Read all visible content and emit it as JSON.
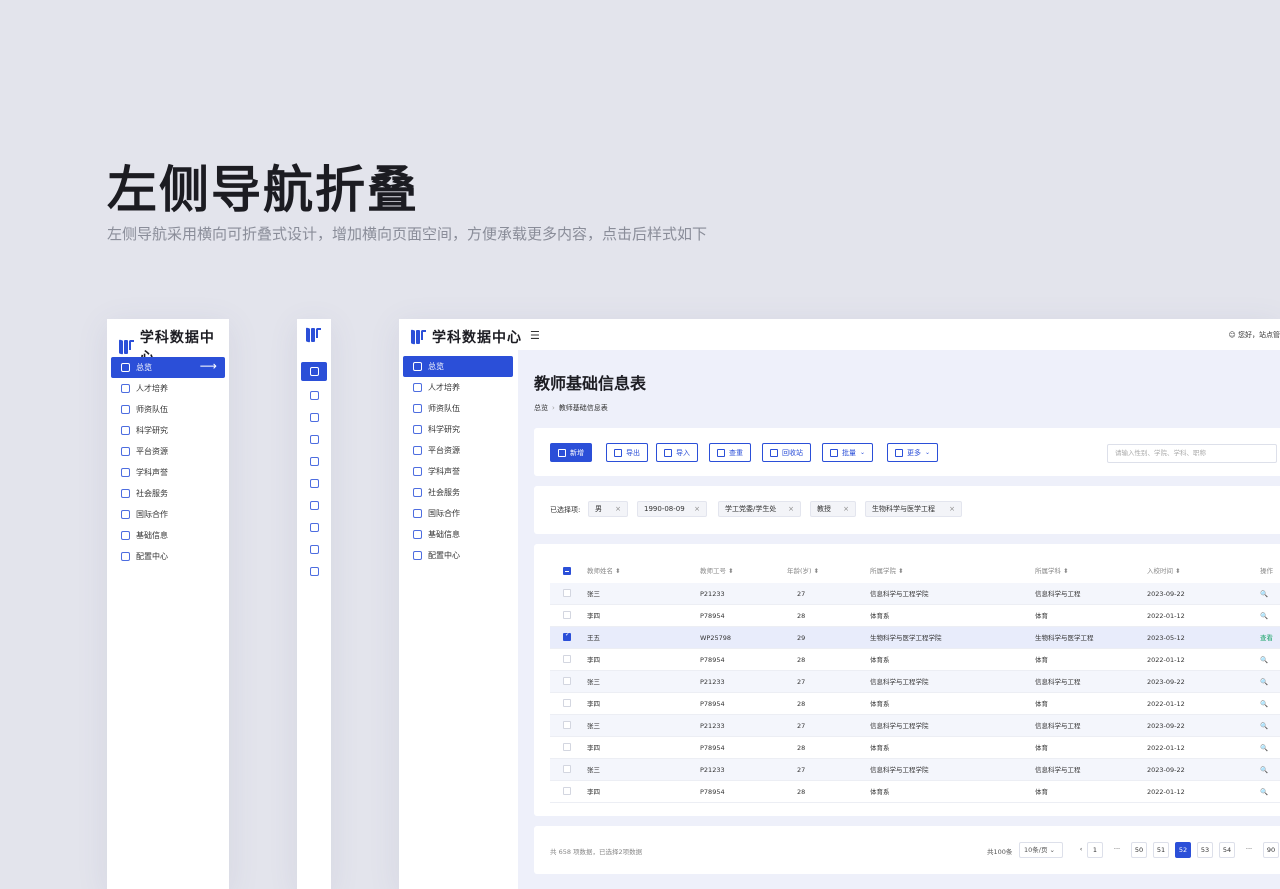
{
  "hero": {
    "title": "左侧导航折叠",
    "subtitle": "左侧导航采用横向可折叠式设计，增加横向页面空间，方便承载更多内容，点击后样式如下"
  },
  "app": {
    "logo_text": "学科数据中心",
    "greeting": "您好，站点管",
    "page_title": "教师基础信息表",
    "breadcrumb": [
      "总览",
      "教师基础信息表"
    ]
  },
  "nav": [
    {
      "label": "总览",
      "icon": "dashboard-icon"
    },
    {
      "label": "人才培养",
      "icon": "user-icon"
    },
    {
      "label": "师资队伍",
      "icon": "graduation-cap-icon"
    },
    {
      "label": "科学研究",
      "icon": "atom-icon"
    },
    {
      "label": "平台资源",
      "icon": "monitor-icon"
    },
    {
      "label": "学科声誉",
      "icon": "award-icon"
    },
    {
      "label": "社会服务",
      "icon": "chat-icon"
    },
    {
      "label": "国际合作",
      "icon": "globe-chat-icon"
    },
    {
      "label": "基础信息",
      "icon": "id-card-icon"
    },
    {
      "label": "配置中心",
      "icon": "settings-panel-icon"
    }
  ],
  "toolbar": {
    "buttons": [
      {
        "label": "新增",
        "icon": "plus-icon"
      },
      {
        "label": "导出",
        "icon": "export-icon"
      },
      {
        "label": "导入",
        "icon": "import-icon"
      },
      {
        "label": "查重",
        "icon": "search-duplicate-icon"
      },
      {
        "label": "回收站",
        "icon": "recycle-bin-icon"
      },
      {
        "label": "批量",
        "icon": "batch-icon"
      },
      {
        "label": "更多",
        "icon": "more-icon"
      }
    ],
    "search_placeholder": "请输入性别、学院、学科、职称"
  },
  "filters": {
    "label": "已选择项:",
    "chips": [
      "男",
      "1990-08-09",
      "学工党委/学生处",
      "教授",
      "生物科学与医学工程"
    ]
  },
  "table": {
    "headers": [
      "教师姓名 ⬍",
      "教师工号 ⬍",
      "年龄(岁) ⬍",
      "所属学院 ⬍",
      "所属学科 ⬍",
      "入校时间 ⬍",
      "操作"
    ],
    "rows": [
      {
        "name": "张三",
        "id": "P21233",
        "age": "27",
        "college": "信息科学与工程学院",
        "subject": "信息科学与工程",
        "date": "2023-09-22",
        "op": "🔍"
      },
      {
        "name": "李四",
        "id": "P78954",
        "age": "28",
        "college": "体育系",
        "subject": "体育",
        "date": "2022-01-12",
        "op": "🔍"
      },
      {
        "name": "王五",
        "id": "WP25798",
        "age": "29",
        "college": "生物科学与医学工程学院",
        "subject": "生物科学与医学工程",
        "date": "2023-05-12",
        "op": "查看"
      },
      {
        "name": "李四",
        "id": "P78954",
        "age": "28",
        "college": "体育系",
        "subject": "体育",
        "date": "2022-01-12",
        "op": "🔍"
      },
      {
        "name": "张三",
        "id": "P21233",
        "age": "27",
        "college": "信息科学与工程学院",
        "subject": "信息科学与工程",
        "date": "2023-09-22",
        "op": "🔍"
      },
      {
        "name": "李四",
        "id": "P78954",
        "age": "28",
        "college": "体育系",
        "subject": "体育",
        "date": "2022-01-12",
        "op": "🔍"
      },
      {
        "name": "张三",
        "id": "P21233",
        "age": "27",
        "college": "信息科学与工程学院",
        "subject": "信息科学与工程",
        "date": "2023-09-22",
        "op": "🔍"
      },
      {
        "name": "李四",
        "id": "P78954",
        "age": "28",
        "college": "体育系",
        "subject": "体育",
        "date": "2022-01-12",
        "op": "🔍"
      },
      {
        "name": "张三",
        "id": "P21233",
        "age": "27",
        "college": "信息科学与工程学院",
        "subject": "信息科学与工程",
        "date": "2023-09-22",
        "op": "🔍"
      },
      {
        "name": "李四",
        "id": "P78954",
        "age": "28",
        "college": "体育系",
        "subject": "体育",
        "date": "2022-01-12",
        "op": "🔍"
      }
    ]
  },
  "pagination": {
    "summary": "共 658 项数据，已选择2项数据",
    "total": "共100条",
    "page_size": "10条/页 ⌄",
    "prev": "‹",
    "pages": [
      "1",
      "···",
      "50",
      "51",
      "52",
      "53",
      "54",
      "···",
      "90"
    ],
    "current": "52"
  },
  "colors": {
    "accent": "#2b4fd8",
    "background": "#e3e4ec",
    "content_bg": "#eef0fa",
    "op_green": "#1aa36a"
  }
}
